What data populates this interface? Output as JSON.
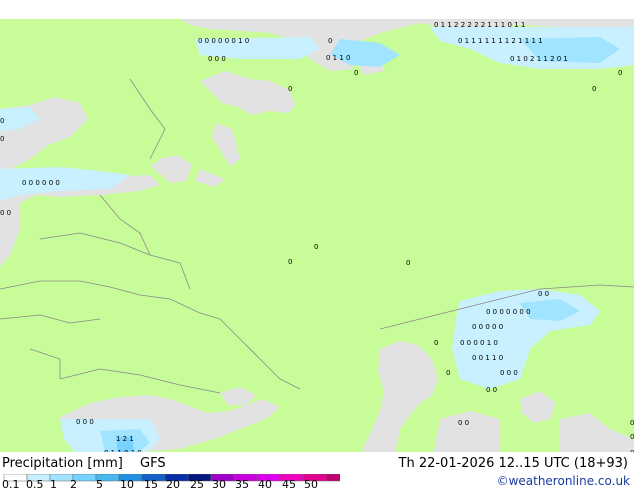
{
  "footer": {
    "title": "Precipitation [mm]",
    "model": "GFS",
    "valid_time": "Th 22-01-2026 12..15 UTC (18+93)",
    "credit": "©weatheronline.co.uk"
  },
  "legend": {
    "ticks": [
      "0.1",
      "0.5",
      "1",
      "2",
      "5",
      "10",
      "15",
      "20",
      "25",
      "30",
      "35",
      "40",
      "45",
      "50"
    ],
    "colors": [
      "#ffffff",
      "#c8f0ff",
      "#a0e4ff",
      "#78d2ff",
      "#4ab8f0",
      "#2090e0",
      "#1060c8",
      "#0830a8",
      "#041880",
      "#a000c8",
      "#c800e0",
      "#e000f0",
      "#f000c0",
      "#e00090",
      "#c00070"
    ]
  },
  "colors": {
    "land": "#c8fc98",
    "sea": "#e2e2e2",
    "precip_light": "#c8f0ff",
    "precip_medium": "#a0e4ff",
    "precip_strong": "#78d2ff",
    "borders": "#8a8a8a"
  },
  "map_labels": [
    {
      "text": "0",
      "lon": 0
    },
    {
      "text": "1"
    },
    {
      "text": "2"
    },
    {
      "text": "6"
    }
  ]
}
